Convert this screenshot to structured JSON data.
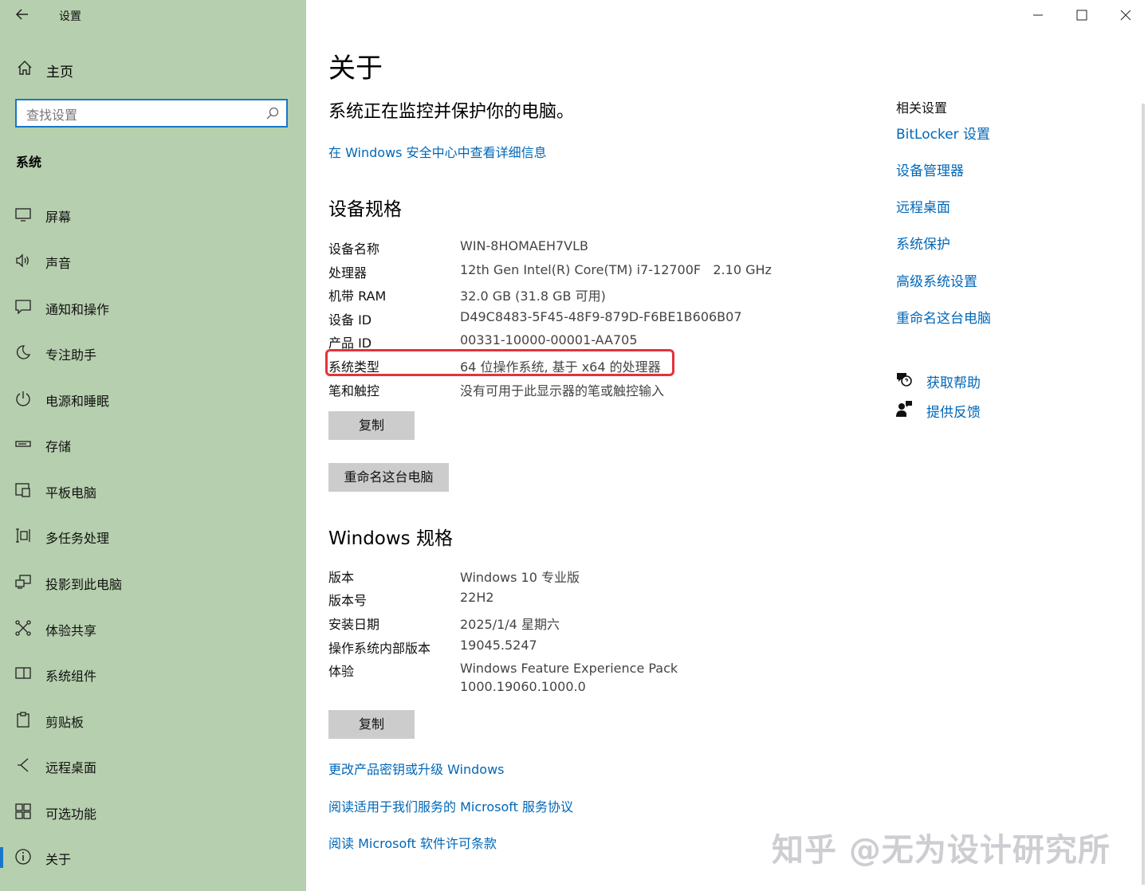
{
  "window": {
    "title": "设置"
  },
  "sidebar": {
    "home_label": "主页",
    "search_placeholder": "查找设置",
    "section_title": "系统",
    "items": [
      {
        "label": "屏幕",
        "icon": "display-icon"
      },
      {
        "label": "声音",
        "icon": "speaker-icon"
      },
      {
        "label": "通知和操作",
        "icon": "notification-icon"
      },
      {
        "label": "专注助手",
        "icon": "moon-icon"
      },
      {
        "label": "电源和睡眠",
        "icon": "power-icon"
      },
      {
        "label": "存储",
        "icon": "storage-icon"
      },
      {
        "label": "平板电脑",
        "icon": "tablet-icon"
      },
      {
        "label": "多任务处理",
        "icon": "multitask-icon"
      },
      {
        "label": "投影到此电脑",
        "icon": "project-icon"
      },
      {
        "label": "体验共享",
        "icon": "share-icon"
      },
      {
        "label": "系统组件",
        "icon": "components-icon"
      },
      {
        "label": "剪贴板",
        "icon": "clipboard-icon"
      },
      {
        "label": "远程桌面",
        "icon": "remote-icon"
      },
      {
        "label": "可选功能",
        "icon": "features-icon"
      },
      {
        "label": "关于",
        "icon": "info-icon",
        "active": true
      }
    ]
  },
  "main": {
    "title": "关于",
    "protection_status": "系统正在监控并保护你的电脑。",
    "security_link": "在 Windows 安全中心中查看详细信息",
    "device_spec": {
      "heading": "设备规格",
      "rows": [
        {
          "key": "设备名称",
          "value": "WIN-8HOMAEH7VLB"
        },
        {
          "key": "处理器",
          "value": "12th Gen Intel(R) Core(TM) i7-12700F   2.10 GHz"
        },
        {
          "key": "机带 RAM",
          "value": "32.0 GB (31.8 GB 可用)"
        },
        {
          "key": "设备 ID",
          "value": "D49C8483-5F45-48F9-879D-F6BE1B606B07"
        },
        {
          "key": "产品 ID",
          "value": "00331-10000-00001-AA705"
        },
        {
          "key": "系统类型",
          "value": "64 位操作系统, 基于 x64 的处理器"
        },
        {
          "key": "笔和触控",
          "value": "没有可用于此显示器的笔或触控输入"
        }
      ],
      "copy_button": "复制",
      "rename_button": "重命名这台电脑"
    },
    "windows_spec": {
      "heading": "Windows 规格",
      "rows": [
        {
          "key": "版本",
          "value": "Windows 10 专业版"
        },
        {
          "key": "版本号",
          "value": "22H2"
        },
        {
          "key": "安装日期",
          "value": "2025/1/4 星期六"
        },
        {
          "key": "操作系统内部版本",
          "value": "19045.5247"
        },
        {
          "key": "体验",
          "value": "Windows Feature Experience Pack",
          "value2": "1000.19060.1000.0"
        }
      ],
      "copy_button": "复制"
    },
    "bottom_links": [
      "更改产品密钥或升级 Windows",
      "阅读适用于我们服务的 Microsoft 服务协议",
      "阅读 Microsoft 软件许可条款"
    ]
  },
  "related": {
    "heading": "相关设置",
    "links": [
      "BitLocker 设置",
      "设备管理器",
      "远程桌面",
      "系统保护",
      "高级系统设置",
      "重命名这台电脑"
    ],
    "help": "获取帮助",
    "feedback": "提供反馈"
  },
  "watermark": "知乎 @无为设计研究所",
  "colors": {
    "sidebar_bg": "#b6cfae",
    "link": "#0067b8",
    "accent": "#1976c8",
    "highlight": "#e2343a"
  }
}
